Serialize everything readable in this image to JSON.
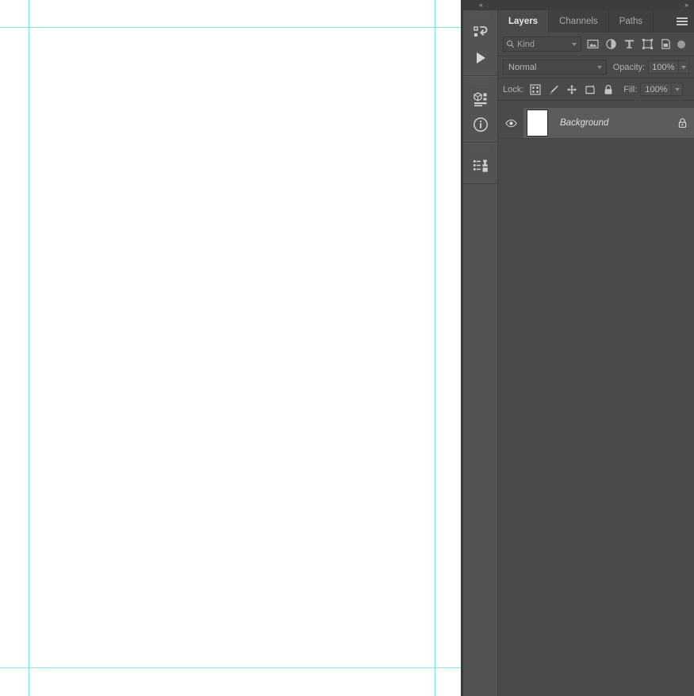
{
  "canvas": {
    "background_color": "#ffffff",
    "guide_color": "#7fe4ea",
    "guides": {
      "vertical": [
        36,
        548
      ],
      "horizontal": [
        34,
        841
      ]
    },
    "edge_color": "#3a3a3a"
  },
  "dock": {
    "collapse_left_icon": "chevron-double-left-icon",
    "collapse_left_glyph": "«",
    "expand_right_icon": "chevron-double-right-icon",
    "expand_right_glyph": "»",
    "background_color": "#4a4a4a",
    "rail_background_color": "#535353",
    "header_color": "#3d3d3d"
  },
  "icon_rail": {
    "groups": [
      {
        "items": [
          {
            "name": "history-panel-icon",
            "label": "History"
          },
          {
            "name": "actions-play-icon",
            "label": "Actions"
          }
        ]
      },
      {
        "items": [
          {
            "name": "properties-panel-icon",
            "label": "Properties"
          },
          {
            "name": "info-panel-icon",
            "label": "Info"
          }
        ]
      },
      {
        "items": [
          {
            "name": "clone-source-panel-icon",
            "label": "Clone Source"
          }
        ]
      }
    ]
  },
  "panel": {
    "tabs": [
      {
        "label": "Layers",
        "active": true
      },
      {
        "label": "Channels",
        "active": false
      },
      {
        "label": "Paths",
        "active": false
      }
    ],
    "menu_icon": "hamburger-menu-icon",
    "filter": {
      "search_icon": "search-icon",
      "kind_value": "Kind",
      "icons": [
        {
          "name": "filter-pixel-layers-icon",
          "label": "Pixel Layers"
        },
        {
          "name": "filter-adjustment-layers-icon",
          "label": "Adjustment Layers"
        },
        {
          "name": "filter-type-layers-icon",
          "label": "Type Layers"
        },
        {
          "name": "filter-shape-layers-icon",
          "label": "Shape Layers"
        },
        {
          "name": "filter-smart-objects-icon",
          "label": "Smart Objects"
        }
      ],
      "toggle_name": "filter-enable-toggle",
      "toggle_color": "#9a9a9a"
    },
    "blend": {
      "mode_value": "Normal",
      "opacity_label": "Opacity:",
      "opacity_value": "100%"
    },
    "lock": {
      "label": "Lock:",
      "icons": [
        {
          "name": "lock-transparent-pixels-icon",
          "label": "Lock transparent pixels"
        },
        {
          "name": "lock-image-pixels-icon",
          "label": "Lock image pixels"
        },
        {
          "name": "lock-position-icon",
          "label": "Lock position"
        },
        {
          "name": "lock-artboard-nesting-icon",
          "label": "Prevent auto-nesting"
        },
        {
          "name": "lock-all-icon",
          "label": "Lock all"
        }
      ],
      "fill_label": "Fill:",
      "fill_value": "100%"
    },
    "layers": [
      {
        "name": "Background",
        "visible": true,
        "locked": true,
        "selected": true,
        "thumbnail_color": "#ffffff"
      }
    ]
  }
}
